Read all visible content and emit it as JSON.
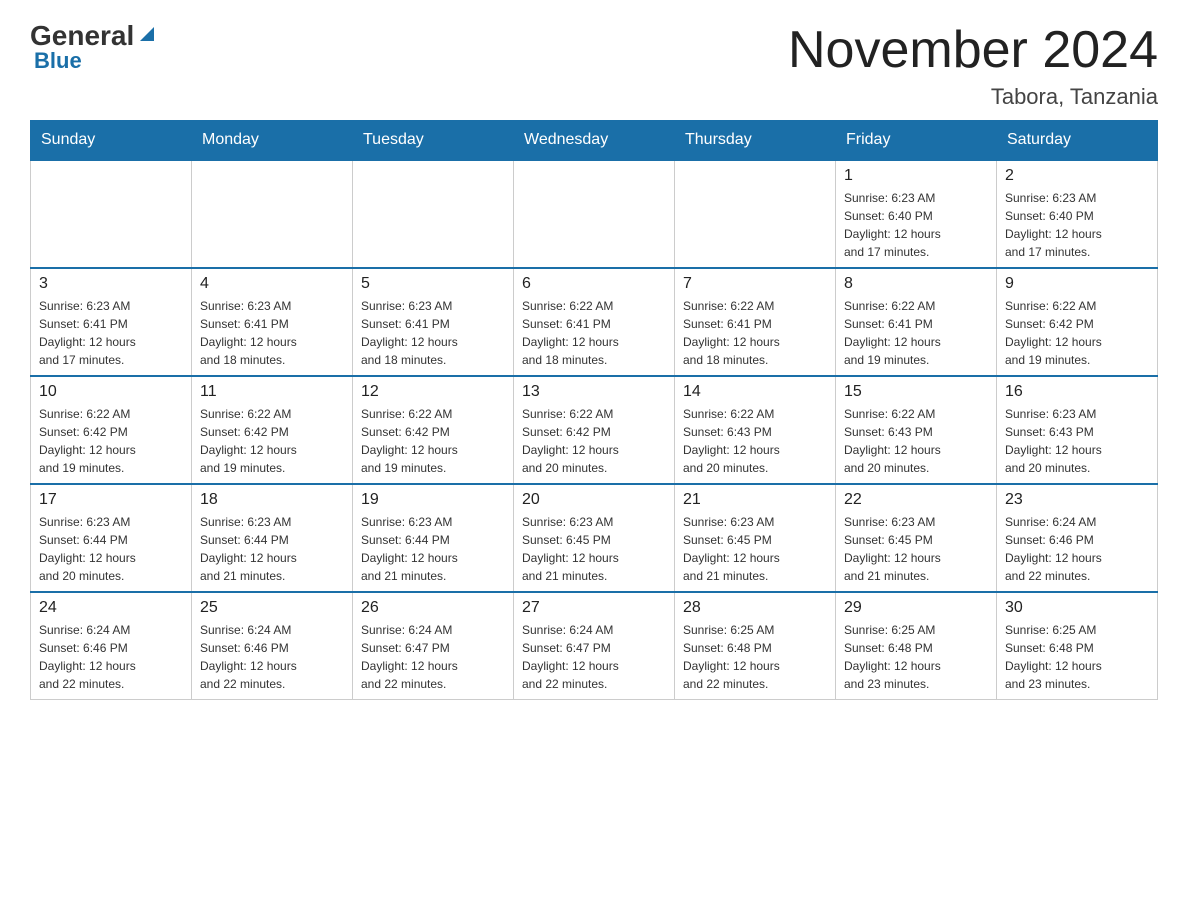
{
  "header": {
    "logo_main": "General",
    "logo_sub": "Blue",
    "month_title": "November 2024",
    "location": "Tabora, Tanzania"
  },
  "weekdays": [
    "Sunday",
    "Monday",
    "Tuesday",
    "Wednesday",
    "Thursday",
    "Friday",
    "Saturday"
  ],
  "weeks": [
    [
      {
        "day": "",
        "info": ""
      },
      {
        "day": "",
        "info": ""
      },
      {
        "day": "",
        "info": ""
      },
      {
        "day": "",
        "info": ""
      },
      {
        "day": "",
        "info": ""
      },
      {
        "day": "1",
        "info": "Sunrise: 6:23 AM\nSunset: 6:40 PM\nDaylight: 12 hours\nand 17 minutes."
      },
      {
        "day": "2",
        "info": "Sunrise: 6:23 AM\nSunset: 6:40 PM\nDaylight: 12 hours\nand 17 minutes."
      }
    ],
    [
      {
        "day": "3",
        "info": "Sunrise: 6:23 AM\nSunset: 6:41 PM\nDaylight: 12 hours\nand 17 minutes."
      },
      {
        "day": "4",
        "info": "Sunrise: 6:23 AM\nSunset: 6:41 PM\nDaylight: 12 hours\nand 18 minutes."
      },
      {
        "day": "5",
        "info": "Sunrise: 6:23 AM\nSunset: 6:41 PM\nDaylight: 12 hours\nand 18 minutes."
      },
      {
        "day": "6",
        "info": "Sunrise: 6:22 AM\nSunset: 6:41 PM\nDaylight: 12 hours\nand 18 minutes."
      },
      {
        "day": "7",
        "info": "Sunrise: 6:22 AM\nSunset: 6:41 PM\nDaylight: 12 hours\nand 18 minutes."
      },
      {
        "day": "8",
        "info": "Sunrise: 6:22 AM\nSunset: 6:41 PM\nDaylight: 12 hours\nand 19 minutes."
      },
      {
        "day": "9",
        "info": "Sunrise: 6:22 AM\nSunset: 6:42 PM\nDaylight: 12 hours\nand 19 minutes."
      }
    ],
    [
      {
        "day": "10",
        "info": "Sunrise: 6:22 AM\nSunset: 6:42 PM\nDaylight: 12 hours\nand 19 minutes."
      },
      {
        "day": "11",
        "info": "Sunrise: 6:22 AM\nSunset: 6:42 PM\nDaylight: 12 hours\nand 19 minutes."
      },
      {
        "day": "12",
        "info": "Sunrise: 6:22 AM\nSunset: 6:42 PM\nDaylight: 12 hours\nand 19 minutes."
      },
      {
        "day": "13",
        "info": "Sunrise: 6:22 AM\nSunset: 6:42 PM\nDaylight: 12 hours\nand 20 minutes."
      },
      {
        "day": "14",
        "info": "Sunrise: 6:22 AM\nSunset: 6:43 PM\nDaylight: 12 hours\nand 20 minutes."
      },
      {
        "day": "15",
        "info": "Sunrise: 6:22 AM\nSunset: 6:43 PM\nDaylight: 12 hours\nand 20 minutes."
      },
      {
        "day": "16",
        "info": "Sunrise: 6:23 AM\nSunset: 6:43 PM\nDaylight: 12 hours\nand 20 minutes."
      }
    ],
    [
      {
        "day": "17",
        "info": "Sunrise: 6:23 AM\nSunset: 6:44 PM\nDaylight: 12 hours\nand 20 minutes."
      },
      {
        "day": "18",
        "info": "Sunrise: 6:23 AM\nSunset: 6:44 PM\nDaylight: 12 hours\nand 21 minutes."
      },
      {
        "day": "19",
        "info": "Sunrise: 6:23 AM\nSunset: 6:44 PM\nDaylight: 12 hours\nand 21 minutes."
      },
      {
        "day": "20",
        "info": "Sunrise: 6:23 AM\nSunset: 6:45 PM\nDaylight: 12 hours\nand 21 minutes."
      },
      {
        "day": "21",
        "info": "Sunrise: 6:23 AM\nSunset: 6:45 PM\nDaylight: 12 hours\nand 21 minutes."
      },
      {
        "day": "22",
        "info": "Sunrise: 6:23 AM\nSunset: 6:45 PM\nDaylight: 12 hours\nand 21 minutes."
      },
      {
        "day": "23",
        "info": "Sunrise: 6:24 AM\nSunset: 6:46 PM\nDaylight: 12 hours\nand 22 minutes."
      }
    ],
    [
      {
        "day": "24",
        "info": "Sunrise: 6:24 AM\nSunset: 6:46 PM\nDaylight: 12 hours\nand 22 minutes."
      },
      {
        "day": "25",
        "info": "Sunrise: 6:24 AM\nSunset: 6:46 PM\nDaylight: 12 hours\nand 22 minutes."
      },
      {
        "day": "26",
        "info": "Sunrise: 6:24 AM\nSunset: 6:47 PM\nDaylight: 12 hours\nand 22 minutes."
      },
      {
        "day": "27",
        "info": "Sunrise: 6:24 AM\nSunset: 6:47 PM\nDaylight: 12 hours\nand 22 minutes."
      },
      {
        "day": "28",
        "info": "Sunrise: 6:25 AM\nSunset: 6:48 PM\nDaylight: 12 hours\nand 22 minutes."
      },
      {
        "day": "29",
        "info": "Sunrise: 6:25 AM\nSunset: 6:48 PM\nDaylight: 12 hours\nand 23 minutes."
      },
      {
        "day": "30",
        "info": "Sunrise: 6:25 AM\nSunset: 6:48 PM\nDaylight: 12 hours\nand 23 minutes."
      }
    ]
  ]
}
